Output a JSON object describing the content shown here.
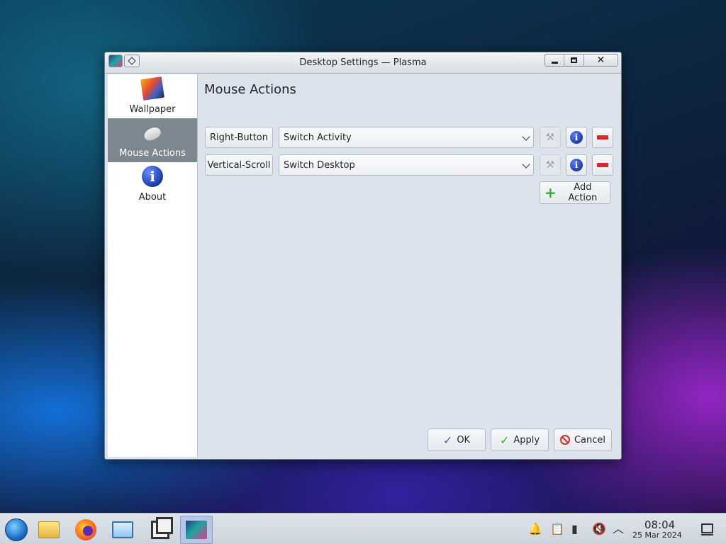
{
  "window": {
    "title": "Desktop Settings — Plasma",
    "minimize_icon": "minimize-icon",
    "maximize_icon": "maximize-icon",
    "close_icon": "close-icon"
  },
  "sidebar": {
    "items": [
      {
        "label": "Wallpaper",
        "icon": "wallpaper-icon",
        "active": false
      },
      {
        "label": "Mouse Actions",
        "icon": "mouse-icon",
        "active": true
      },
      {
        "label": "About",
        "icon": "info-icon",
        "active": false
      }
    ]
  },
  "main": {
    "title": "Mouse Actions",
    "actions": [
      {
        "trigger": "Right-Button",
        "plugin": "Switch Activity"
      },
      {
        "trigger": "Vertical-Scroll",
        "plugin": "Switch Desktop"
      }
    ],
    "add_action_label": "Add Action"
  },
  "footer": {
    "ok_label": "OK",
    "apply_label": "Apply",
    "cancel_label": "Cancel"
  },
  "taskbar": {
    "apps": [
      "start-menu",
      "file-manager",
      "firefox",
      "system-settings",
      "window-switcher",
      "plasma-settings"
    ],
    "clock_time": "08:04",
    "clock_date": "25 Mar 2024",
    "tray_icons": [
      "notifications-icon",
      "clipboard-icon",
      "battery-icon",
      "volume-muted-icon",
      "tray-expand-icon"
    ]
  },
  "colors": {
    "selected_sidebar": "#7c8790",
    "remove_red": "#d62a2a",
    "info_blue": "#1a39a5",
    "add_green": "#2fae2f"
  }
}
